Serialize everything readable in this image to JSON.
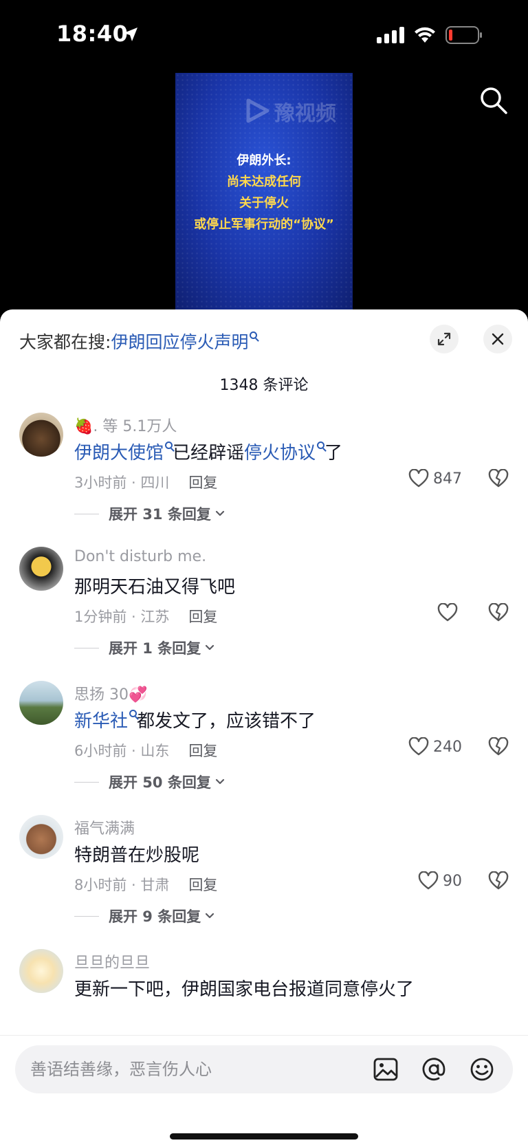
{
  "status": {
    "time": "18:40",
    "icons": [
      "location-arrow-icon",
      "cellular-signal-icon",
      "wifi-icon",
      "battery-low-icon"
    ]
  },
  "video": {
    "watermark": "豫视频",
    "lines": [
      "伊朗外长:",
      "尚未达成任何",
      "关于停火",
      "或停止军事行动的“协议”"
    ]
  },
  "panel": {
    "hot_search_label": "大家都在搜:",
    "hot_search_term": "伊朗回应停火声明",
    "comment_count": "1348 条评论"
  },
  "comments": [
    {
      "user_prefix": "🍓",
      "user": ". 等 5.1万人",
      "text_parts": [
        {
          "t": "伊朗大使馆",
          "link": true
        },
        {
          "t": "已经辟谣",
          "link": false
        },
        {
          "t": "停火协议",
          "link": true
        },
        {
          "t": "了",
          "link": false
        }
      ],
      "meta": "3小时前 · 四川",
      "reply": "回复",
      "likes": "847",
      "expand": "展开 31 条回复"
    },
    {
      "user": "Don't disturb me.",
      "text_parts": [
        {
          "t": "那明天石油又得飞吧",
          "link": false
        }
      ],
      "meta": "1分钟前 · 江苏",
      "reply": "回复",
      "likes": "",
      "expand": "展开 1 条回复"
    },
    {
      "user": "思扬 30💞",
      "text_parts": [
        {
          "t": "新华社",
          "link": true
        },
        {
          "t": "都发文了，应该错不了",
          "link": false
        }
      ],
      "meta": "6小时前 · 山东",
      "reply": "回复",
      "likes": "240",
      "expand": "展开 50 条回复"
    },
    {
      "user": "福气满满",
      "text_parts": [
        {
          "t": "特朗普在炒股呢",
          "link": false
        }
      ],
      "meta": "8小时前 · 甘肃",
      "reply": "回复",
      "likes": "90",
      "expand": "展开 9 条回复"
    },
    {
      "user": "旦旦的旦旦",
      "text_parts": [
        {
          "t": "更新一下吧，伊朗国家电台报道同意停火了",
          "link": false
        }
      ],
      "meta": "",
      "reply": "",
      "likes": "",
      "expand": ""
    }
  ],
  "input": {
    "placeholder": "善语结善缘，恶言伤人心"
  },
  "colors": {
    "link": "#2a5bb5",
    "video_bg": "#1a35a8",
    "video_highlight": "#ffd84d"
  }
}
